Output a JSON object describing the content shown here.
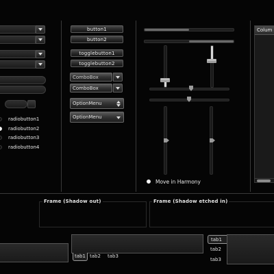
{
  "col1": {
    "spin_value": ""
  },
  "buttons": {
    "button1": "button1",
    "button2": "button2",
    "togglebutton1": "togglebutton1",
    "togglebutton2": "togglebutton2"
  },
  "combos": {
    "combobox1": "ComboBox",
    "combobox2": "ComboBox"
  },
  "optionmenus": {
    "option1": "OptionMenu",
    "option2": "OptionMenu"
  },
  "radios": [
    {
      "label": "radiobutton1",
      "checked": false
    },
    {
      "label": "radiobutton2",
      "checked": true
    },
    {
      "label": "radiobutton3",
      "checked": false
    },
    {
      "label": "radiobutton4",
      "checked": false
    }
  ],
  "progress": {
    "top_fraction": 0.5,
    "second_fraction": 0.5
  },
  "move_in_harmony": "Move in Harmony",
  "tree": {
    "column_header": "Colum"
  },
  "frames": {
    "shadow_out": "Frame (Shadow out)",
    "shadow_etched_in": "Frame (Shadow etched in)"
  },
  "notebook1": {
    "tabs": [
      "tab1",
      "tab2",
      "tab3"
    ],
    "active": 0
  },
  "notebook2": {
    "tabs": [
      "tab1",
      "tab2",
      "tab3"
    ],
    "active": 0
  }
}
